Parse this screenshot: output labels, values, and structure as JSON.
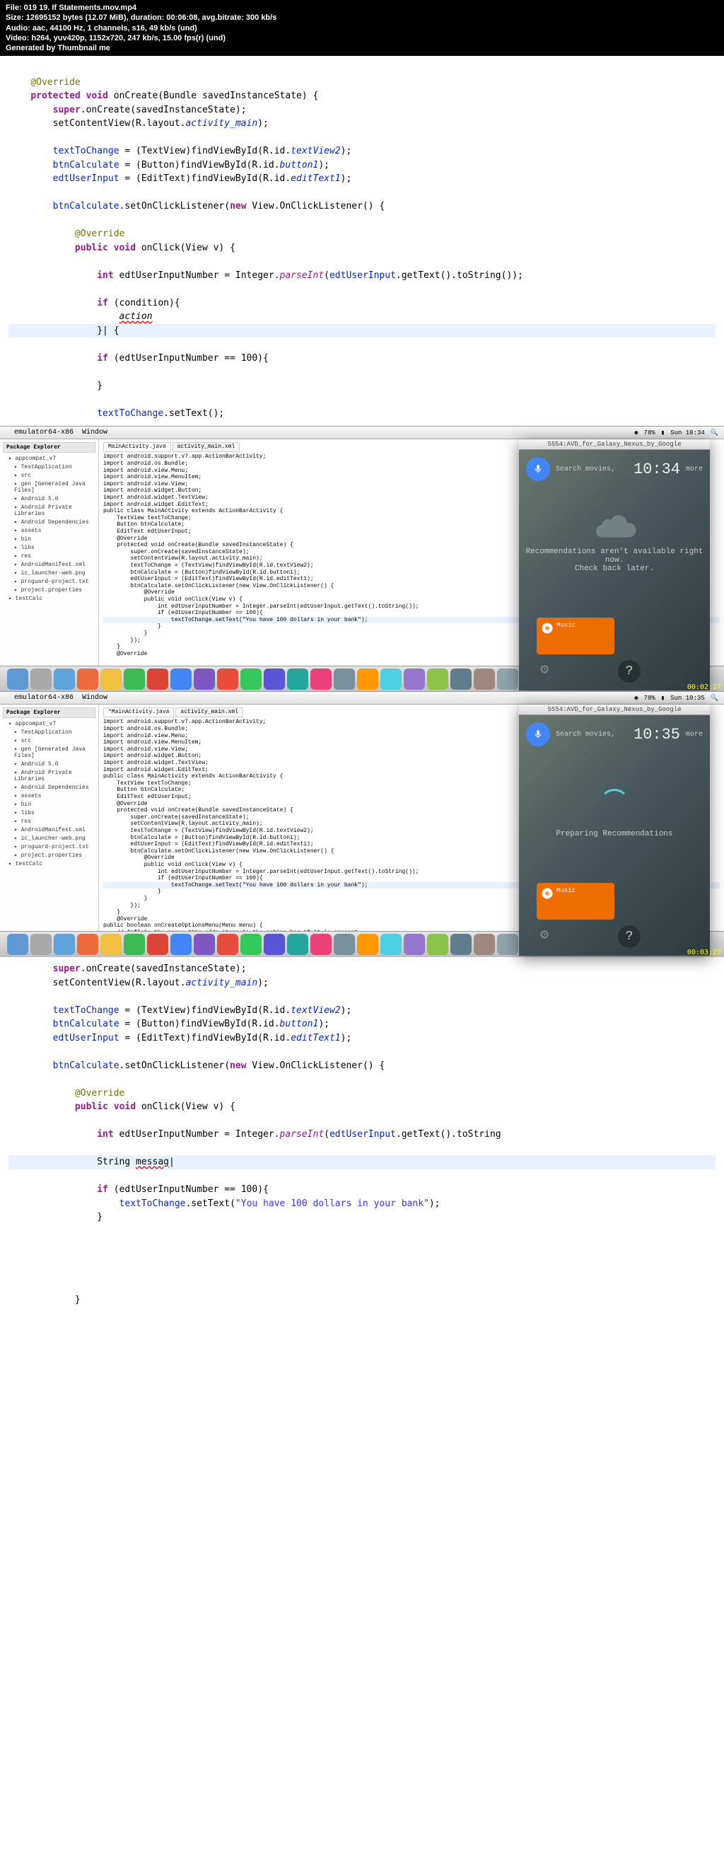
{
  "header": {
    "file": "File: 019 19. If Statements.mov.mp4",
    "size": "Size: 12695152 bytes (12.07 MiB), duration: 00:06:08, avg.bitrate: 300 kb/s",
    "audio": "Audio: aac, 44100 Hz, 1 channels, s16, 49 kb/s (und)",
    "video": "Video: h264, yuv420p, 1152x720, 247 kb/s, 15.00 fps(r) (und)",
    "gen": "Generated by Thumbnail me"
  },
  "code1": {
    "override": "@Override",
    "protected": "protected",
    "void": "void",
    "onCreate": "onCreate(Bundle savedInstanceState) {",
    "super": "super",
    "superCall": ".onCreate(savedInstanceState);",
    "setContent": "setContentView(R.layout.",
    "activityMain": "activity_main",
    "close": ");",
    "textToChange": "textToChange",
    "eq": " = (TextView)findViewById(R.id.",
    "textView2": "textView2",
    "btnCalculate": "btnCalculate",
    "eqBtn": " = (Button)findViewById(R.id.",
    "button1": "button1",
    "edtUserInput": "edtUserInput",
    "eqEdt": " = (EditText)findViewById(R.id.",
    "editText1": "editText1",
    "btnCalc2": "btnCalculate",
    "setOnClick": ".setOnClickListener(",
    "new": "new",
    "viewOnClick": " View.OnClickListener() {",
    "override2": "@Override",
    "public": "public",
    "void2": "void",
    "onClick": "onClick(View v) {",
    "int": "int",
    "edtNum": " edtUserInputNumber = Integer.",
    "parseInt": "parseInt",
    "lparen": "(",
    "edtUI": "edtUserInput",
    "getText": ".getText().toString());",
    "if": "if",
    "cond": " (condition){",
    "action": "action",
    "brace": "}|    {",
    "if2": "if",
    "cond2": " (edtUserInputNumber == 100){",
    "closeBrace": "}",
    "ttc": "textToChange",
    "setText": ".setText();"
  },
  "ide1": {
    "menubar": {
      "app": "emulator64-x86",
      "item": "Window",
      "right": "78%",
      "time": "Sun 10:34"
    },
    "pkgTitle": "Package Explorer",
    "tree": [
      "appcompat_v7",
      "TestApplication",
      "src",
      "gen [Generated Java Files]",
      "Android 5.0",
      "Android Private Libraries",
      "Android Dependencies",
      "assets",
      "bin",
      "libs",
      "res",
      "AndroidManifest.xml",
      "ic_launcher-web.png",
      "proguard-project.txt",
      "project.properties",
      "testCalc"
    ],
    "tabs": [
      "MainActivity.java",
      "activity_main.xml"
    ],
    "emuTitle": "5554:AVD_for_Galaxy_Nexus_by_Google",
    "search": "Search movies,",
    "clock": "10:34",
    "more": "more",
    "rec1": "Recommendations aren't available right now.",
    "rec2": "Check back later.",
    "music": "Music",
    "ts": "00:02:27"
  },
  "miniCode1": {
    "lines": [
      "import android.support.v7.app.ActionBarActivity;",
      "import android.os.Bundle;",
      "import android.view.Menu;",
      "import android.view.MenuItem;",
      "import android.view.View;",
      "import android.widget.Button;",
      "import android.widget.TextView;",
      "import android.widget.EditText;",
      "",
      "public class MainActivity extends ActionBarActivity {",
      "",
      "    TextView textToChange;",
      "    Button btnCalculate;",
      "    EditText edtUserInput;",
      "",
      "    @Override",
      "    protected void onCreate(Bundle savedInstanceState) {",
      "        super.onCreate(savedInstanceState);",
      "        setContentView(R.layout.activity_main);",
      "",
      "        textToChange = (TextView)findViewById(R.id.textView2);",
      "        btnCalculate = (Button)findViewById(R.id.button1);",
      "        edtUserInput = (EditText)findViewById(R.id.editText1);",
      "",
      "        btnCalculate.setOnClickListener(new View.OnClickListener() {",
      "",
      "            @Override",
      "            public void onClick(View v) {",
      "",
      "                int edtUserInputNumber = Integer.parseInt(edtUserInput.getText().toString());",
      "",
      "                if (edtUserInputNumber == 100){",
      "                    textToChange.setText(\"You have 100 dollars in your bank\");",
      "                }",
      "",
      "            }",
      "        });",
      "",
      "    }",
      "",
      "    @Override"
    ]
  },
  "ide2": {
    "menubar": {
      "app": "emulator64-x86",
      "item": "Window",
      "right": "78%",
      "time": "Sun 10:35"
    },
    "pkgTitle": "Package Explorer",
    "tabs": [
      "*MainActivity.java",
      "activity_main.xml"
    ],
    "emuTitle": "5554:AVD_for_Galaxy_Nexus_by_Google",
    "search": "Search movies,",
    "clock": "10:35",
    "more": "more",
    "prep": "Preparing Recommendations",
    "music": "Music",
    "ts": "00:03:27"
  },
  "miniCode2": {
    "extra": "public boolean onCreateOptionsMenu(Menu menu) {",
    "comment": "// Inflate the menu; this adds items to the action bar if it is present."
  },
  "code2": {
    "super": "super",
    "superCall": ".onCreate(savedInstanceState);",
    "setContent": "setContentView(R.layout.",
    "activityMain": "activity_main",
    "close": ");",
    "textToChange": "textToChange",
    "eq": " = (TextView)findViewById(R.id.",
    "textView2": "textView2",
    "btnCalculate": "btnCalculate",
    "eqBtn": " = (Button)findViewById(R.id.",
    "button1": "button1",
    "edtUserInput": "edtUserInput",
    "eqEdt": " = (EditText)findViewById(R.id.",
    "editText1": "editText1",
    "btnCalc2": "btnCalculate",
    "setOnClick": ".setOnClickListener(",
    "new": "new",
    "viewOnClick": " View.OnClickListener() {",
    "override": "@Override",
    "public": "public",
    "void": "void",
    "onClick": "onClick(View v) {",
    "int": "int",
    "edtNum": " edtUserInputNumber = Integer.",
    "parseInt": "parseInt",
    "lparen": "(",
    "edtUI": "edtUserInput",
    "getText": ".getText().toString",
    "stringDecl": "String ",
    "messag": "messag",
    "if": "if",
    "cond": " (edtUserInputNumber == 100){",
    "ttc": "textToChange",
    "setText": ".setText(",
    "str": "\"You have 100 dollars in your bank\"",
    "closeCall": ");",
    "closeBrace": "}",
    "final": "}"
  },
  "dock": {
    "colors": [
      "#6099d4",
      "#a8a8a8",
      "#5ea3d9",
      "#ed6b3c",
      "#f0c040",
      "#3cba54",
      "#db4437",
      "#4285f4",
      "#7e57c2",
      "#e74c3c",
      "#34c759",
      "#5856d6",
      "#26a69a",
      "#ec407a",
      "#78909c",
      "#ff9800",
      "#4dd0e1",
      "#9575cd",
      "#8bc34a",
      "#607d8b",
      "#a1887f",
      "#90a4ae",
      "#bdbdbd",
      "#616161",
      "#424242",
      "#9e9e9e"
    ]
  }
}
